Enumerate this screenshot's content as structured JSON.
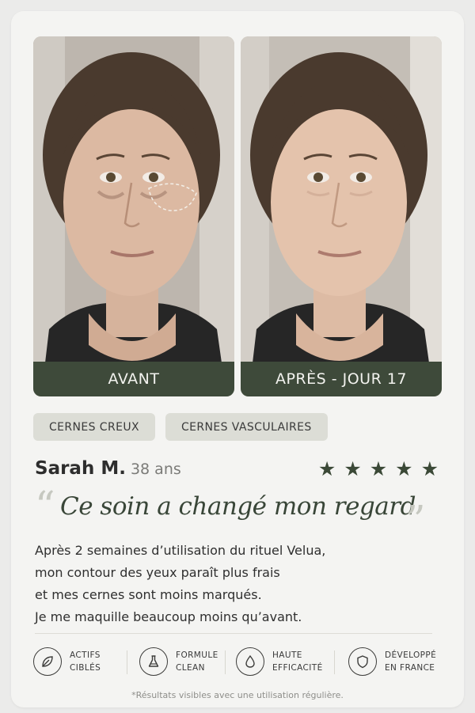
{
  "before_after": {
    "before_label": "AVANT",
    "after_label": "APRÈS - JOUR 17"
  },
  "tags": [
    "CERNES CREUX",
    "CERNES VASCULAIRES"
  ],
  "reviewer": {
    "name": "Sarah M.",
    "age": "38 ans",
    "rating": 5
  },
  "review": {
    "headline": "Ce soin a changé mon regard",
    "body_lines": [
      "Après 2 semaines d’utilisation du rituel Velua,",
      "mon contour des yeux paraît plus frais",
      "et mes cernes sont moins marqués.",
      "Je me maquille beaucoup moins qu’avant."
    ]
  },
  "features": [
    {
      "icon": "leaf-icon",
      "line1": "ACTIFS",
      "line2": "CIBLÉS"
    },
    {
      "icon": "flask-icon",
      "line1": "FORMULE",
      "line2": "CLEAN"
    },
    {
      "icon": "drop-icon",
      "line1": "HAUTE",
      "line2": "EFFICACITÉ"
    },
    {
      "icon": "shield-icon",
      "line1": "DÉVELOPPÉ",
      "line2": "EN FRANCE"
    }
  ],
  "footnote": "*Résultats visibles avec une utilisation régulière.",
  "colors": {
    "accent": "#3e4a3a",
    "tag_bg": "#dcddd6",
    "card_bg": "#f4f4f2"
  }
}
